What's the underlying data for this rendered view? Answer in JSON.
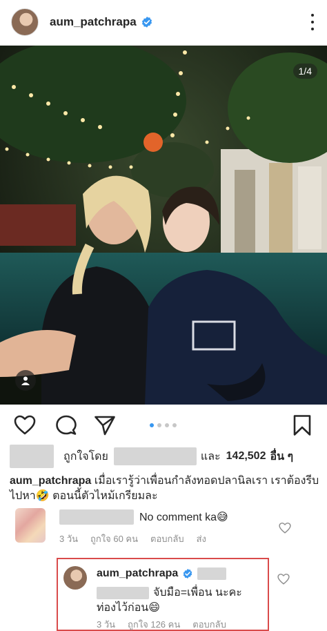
{
  "header": {
    "username": "aum_patchrapa"
  },
  "photo": {
    "counter": "1/4"
  },
  "likes": {
    "liked_by_label": "ถูกใจโดย",
    "and_label": "และ",
    "count": "142,502",
    "others_label": "อื่น ๆ"
  },
  "caption": {
    "username": "aum_patchrapa",
    "text": "เมื่อเรารู้ว่าเพื่อนกำลังทอดปลานิลเรา เราต้องรีบไปหา🤣 ตอนนี้ตัวไหม้เกรียมละ"
  },
  "comments": [
    {
      "text": "No comment ka😅",
      "time": "3 วัน",
      "likes": "ถูกใจ 60 คน",
      "reply": "ตอบกลับ",
      "send": "ส่ง"
    }
  ],
  "reply": {
    "username": "aum_patchrapa",
    "line1": "จับมือ=เพื่อน นะคะ",
    "line2": "ท่องไว้ก่อน😄",
    "time": "3 วัน",
    "likes": "ถูกใจ 126 คน",
    "reply": "ตอบกลับ"
  },
  "colors": {
    "verified": "#3897f0",
    "accent_dot": "#3897f0",
    "highlight_border": "#d94a4a"
  }
}
